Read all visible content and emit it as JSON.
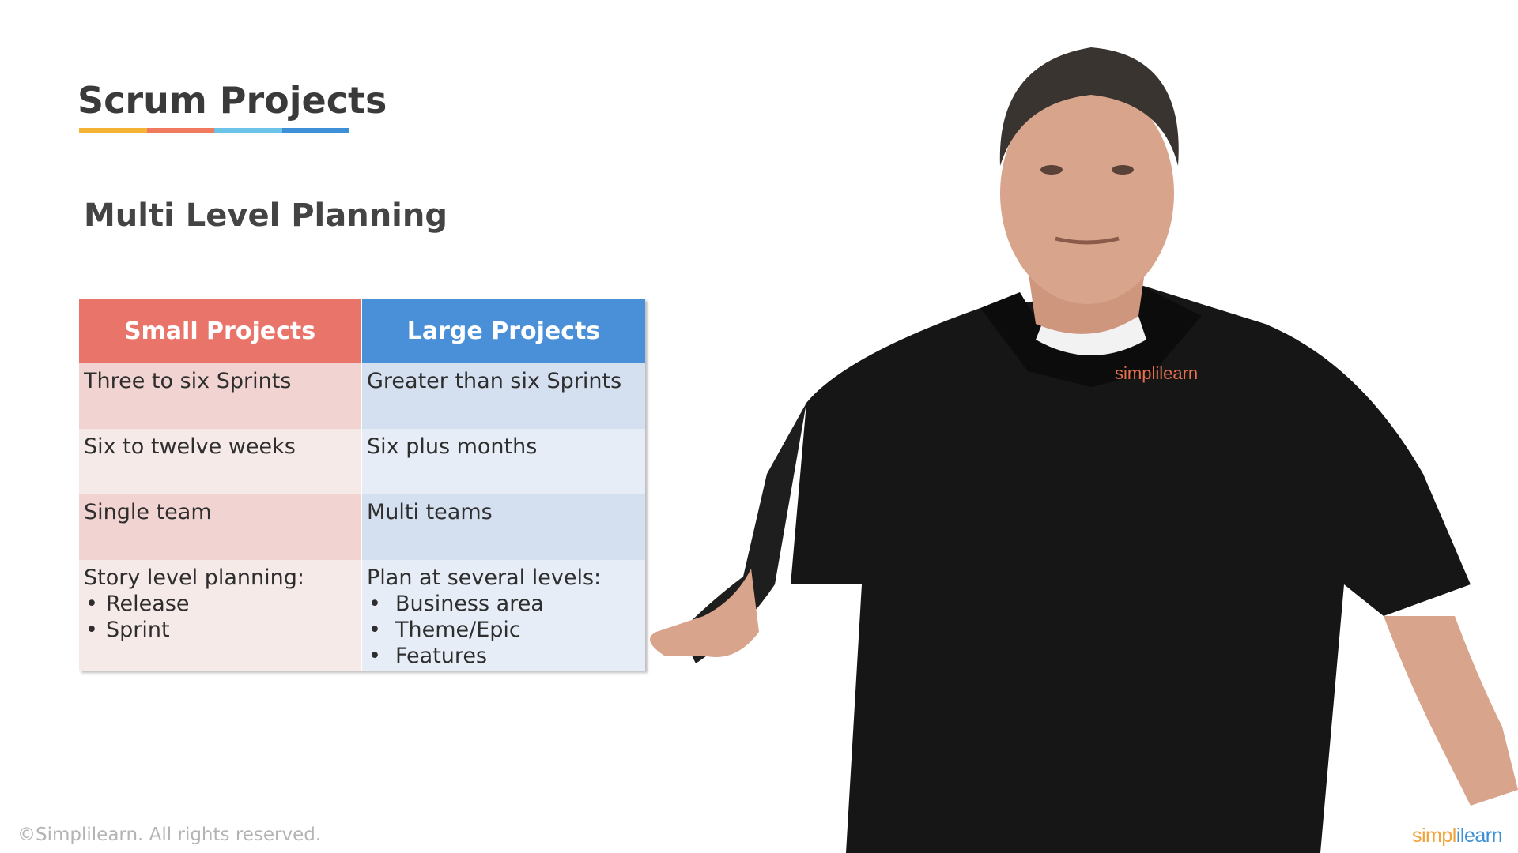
{
  "slide": {
    "title": "Scrum Projects",
    "underline_colors": [
      "#f5b335",
      "#ef7a5e",
      "#6cc3e8",
      "#3d8fd8"
    ],
    "subtitle": "Multi Level Planning"
  },
  "table": {
    "colors": {
      "small_header": "#e9746a",
      "large_header": "#4a90d9",
      "small_dark": "#f1d4d1",
      "small_light": "#f6eae8",
      "large_dark": "#d4dff0",
      "large_light": "#e6edf6"
    },
    "headers": [
      "Small Projects",
      "Large Projects"
    ],
    "rows": [
      {
        "small": "Three to six Sprints",
        "large": "Greater than six Sprints"
      },
      {
        "small": "Six to twelve weeks",
        "large": "Six plus months"
      },
      {
        "small": "Single team",
        "large": "Multi teams"
      }
    ],
    "last_row": {
      "small_heading": "Story level planning:",
      "small_items": [
        "Release",
        "Sprint"
      ],
      "large_heading": "Plan at several levels:",
      "large_items": [
        "Business area",
        "Theme/Epic",
        "Features"
      ]
    }
  },
  "presenter": {
    "shirt_logo": "simplilearn"
  },
  "footer": {
    "copyright": "©Simplilearn. All rights reserved.",
    "brand_part1": "simpl",
    "brand_part2": "ilearn",
    "brand_colors": [
      "#f2a33a",
      "#3a8fd6"
    ]
  }
}
